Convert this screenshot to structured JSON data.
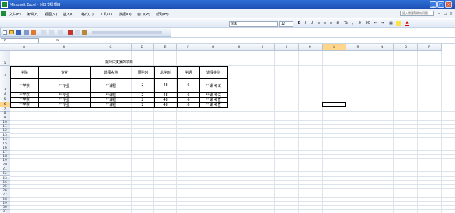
{
  "titlebar": {
    "title": "Microsoft Excel - 对口支援项目"
  },
  "menubar": {
    "items": [
      "文件(F)",
      "编辑(E)",
      "视图(V)",
      "插入(I)",
      "格式(O)",
      "工具(T)",
      "数据(D)",
      "窗口(W)",
      "帮助(H)"
    ],
    "help_placeholder": "键入需要帮助的问题"
  },
  "toolbar": {
    "font_name": "宋体",
    "font_size": "12",
    "format_buttons": [
      "B",
      "I",
      "U",
      "≡",
      "≡",
      "≡",
      "⊞",
      "%",
      ",",
      ".0",
      ".00",
      "⇤",
      "⇥",
      "▦",
      "A"
    ]
  },
  "formula_bar": {
    "name_box": "L6",
    "fx": "fx",
    "content": ""
  },
  "columns": [
    "A",
    "B",
    "C",
    "D",
    "E",
    "F",
    "G",
    "H",
    "I",
    "J",
    "K",
    "L",
    "M",
    "N",
    "O",
    "P"
  ],
  "active_cell": {
    "column": "L",
    "row": "6"
  },
  "rows": [
    "1",
    "2",
    "3",
    "4",
    "5",
    "6",
    "7",
    "8",
    "9",
    "10",
    "11",
    "12",
    "13",
    "14",
    "15",
    "16",
    "17",
    "18",
    "19",
    "20",
    "21",
    "22",
    "23",
    "24",
    "25",
    "26",
    "27",
    "28",
    "29",
    "30",
    "31"
  ],
  "sheet": {
    "title": "需对口支援的项目",
    "headers": [
      "学院",
      "专业",
      "课程名称",
      "周学时",
      "总学时",
      "学期",
      "课程类别"
    ],
    "rows": [
      [
        "**学院",
        "**专业",
        "**课程",
        "2",
        "48",
        "6",
        "**课  考试"
      ],
      [
        "**学院",
        "**专业",
        "**课程",
        "2",
        "48",
        "6",
        "**课  考试"
      ],
      [
        "**学院",
        "**专业",
        "**课程",
        "2",
        "48",
        "6",
        "**课  考查"
      ],
      [
        "**学院",
        "**专业",
        "**课程",
        "2",
        "48",
        "6",
        "**课  考查"
      ]
    ]
  }
}
